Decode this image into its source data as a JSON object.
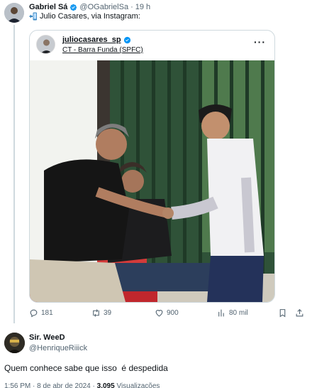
{
  "tweet": {
    "author_name": "Gabriel Sá",
    "author_handle": "@OGabrielSa",
    "separator": "·",
    "time": "19 h",
    "text": "Julio Casares, via Instagram:",
    "embed": {
      "username": "juliocasares_sp",
      "location": "CT - Barra Funda (SPFC)",
      "more_label": "···"
    },
    "stats": {
      "replies": "181",
      "retweets": "39",
      "likes": "900",
      "views": "80 mil"
    }
  },
  "reply": {
    "author_name": "Sir. WeeD",
    "author_handle": "@HenriqueRiiick",
    "text": "Quem conhece sabe que isso  é despedida",
    "time": "1:56 PM · 8 de abr de 2024 · ",
    "views_count": "3.095",
    "views_label": "Visualizações"
  },
  "colors": {
    "verified": "#1d9bf0",
    "secondary_text": "#536471",
    "thread_line": "#cfd9de"
  }
}
